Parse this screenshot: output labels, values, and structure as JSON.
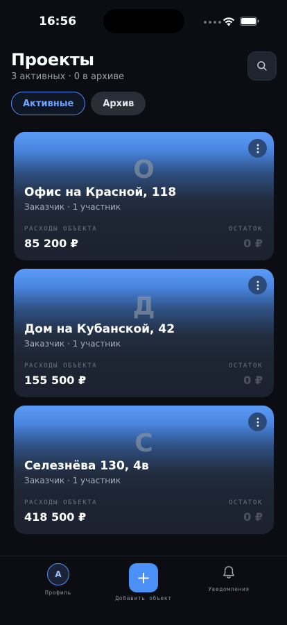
{
  "status": {
    "time": "16:56"
  },
  "header": {
    "title": "Проекты",
    "subtitle": "3 активных · 0 в архиве"
  },
  "tabs": [
    {
      "label": "Активные",
      "active": true
    },
    {
      "label": "Архив",
      "active": false
    }
  ],
  "projects": [
    {
      "letter": "О",
      "title": "Офис на Красной, 118",
      "meta": "Заказчик · 1 участник",
      "expense_label": "РАСХОДЫ ОБЪЕКТА",
      "expense": "85 200 ₽",
      "balance_label": "ОСТАТОК",
      "balance": "0 ₽"
    },
    {
      "letter": "Д",
      "title": "Дом на Кубанской, 42",
      "meta": "Заказчик · 1 участник",
      "expense_label": "РАСХОДЫ ОБЪЕКТА",
      "expense": "155 500 ₽",
      "balance_label": "ОСТАТОК",
      "balance": "0 ₽"
    },
    {
      "letter": "С",
      "title": "Селезнёва 130, 4в",
      "meta": "Заказчик · 1 участник",
      "expense_label": "РАСХОДЫ ОБЪЕКТА",
      "expense": "418 500 ₽",
      "balance_label": "ОСТАТОК",
      "balance": "0 ₽"
    }
  ],
  "nav": {
    "profile_initial": "А",
    "profile_label": "Профиль",
    "add_icon": "+",
    "add_label": "Добавить объект",
    "notify_label": "Уведомления"
  },
  "colors": {
    "accent": "#4a90f7",
    "background": "#0b0d12",
    "card": "#1c2230"
  },
  "icons": {
    "search": "search-icon",
    "menu": "more-vertical-icon",
    "bell": "bell-icon",
    "add": "plus-icon"
  }
}
